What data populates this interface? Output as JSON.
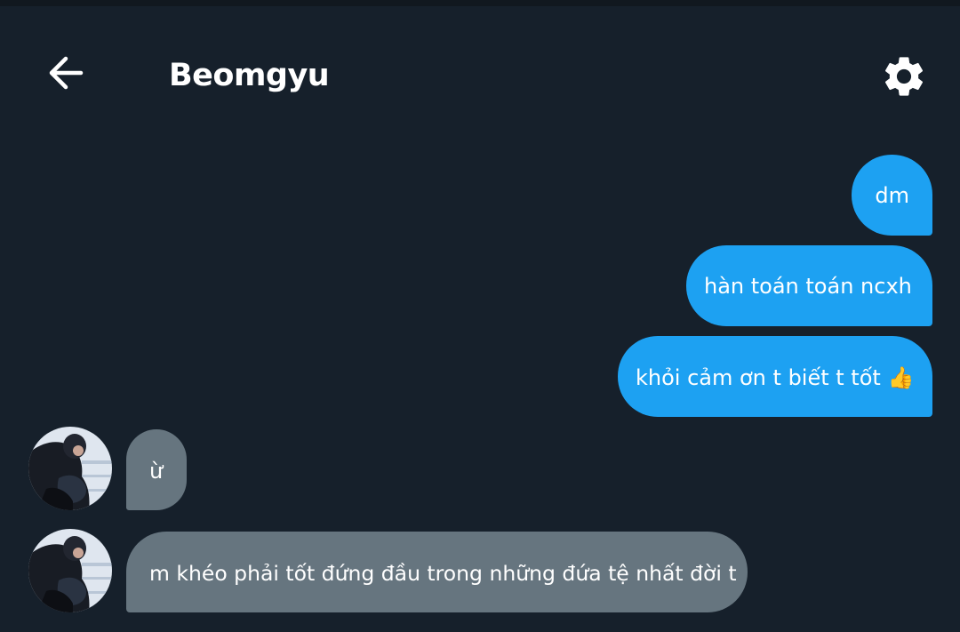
{
  "header": {
    "back_icon": "arrow-left-icon",
    "title": "Beomgyu",
    "settings_icon": "gear-icon"
  },
  "colors": {
    "background": "#16202b",
    "outgoing_bubble": "#1da1f2",
    "incoming_bubble": "#66757f",
    "text": "#ffffff"
  },
  "messages": [
    {
      "direction": "outgoing",
      "text": "dm"
    },
    {
      "direction": "outgoing",
      "text": "hàn toán toán ncxh"
    },
    {
      "direction": "outgoing",
      "text": "khỏi cảm ơn t biết t tốt 👍"
    },
    {
      "direction": "incoming",
      "text": "ừ",
      "avatar_icon": "user-avatar"
    },
    {
      "direction": "incoming",
      "text": "m khéo phải tốt đứng đầu trong những đứa tệ nhất đời t",
      "avatar_icon": "user-avatar"
    }
  ]
}
